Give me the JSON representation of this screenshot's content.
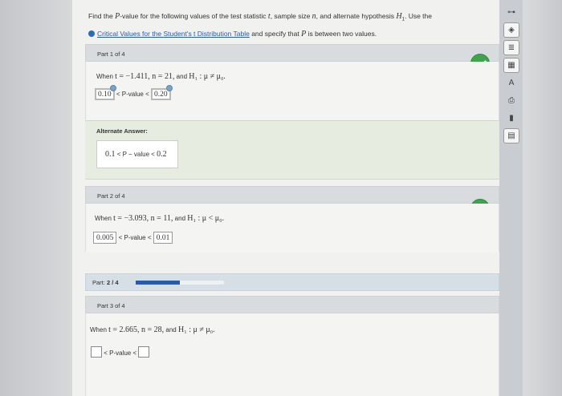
{
  "intro": {
    "line1_pre": "Find the ",
    "line1_p": "P",
    "line1_mid": "-value for the following values of the test statistic ",
    "line1_t": "t",
    "line1_mid2": ", sample size ",
    "line1_n": "n",
    "line1_mid3": ", and alternate hypothesis ",
    "line1_h": "H",
    "line1_h_sub": "1",
    "line1_end": ". Use the",
    "link_text": "Critical Values for the Student's t Distribution Table",
    "line2_mid": " and specify that ",
    "line2_p": "P",
    "line2_end": " is between two values."
  },
  "part1": {
    "label": "Part 1 of 4",
    "when_text": "When ",
    "stat": "t = −1.411, n = 21,",
    "and_text": " and ",
    "hyp": "H₁ : μ ≠ μ₀.",
    "lower": "0.10",
    "mid_text": " < P-value < ",
    "upper": "0.20"
  },
  "alternate": {
    "title": "Alternate Answer:",
    "answer_lower": "0.1",
    "answer_mid": " < P − value < ",
    "answer_upper": "0.2"
  },
  "part2": {
    "label": "Part 2 of 4",
    "when_text": "When ",
    "stat": "t = −3.093, n = 11,",
    "and_text": " and ",
    "hyp": "H₁ : μ < μ₀.",
    "lower": "0.005",
    "mid_text": " < P-value < ",
    "upper": "0.01"
  },
  "progress": {
    "label_prefix": "Part: ",
    "label_value": "2 / 4",
    "fraction": 0.5
  },
  "part3": {
    "label": "Part 3 of 4",
    "when_text": "When ",
    "stat": "t = 2.665, n = 28,",
    "and_text": " and ",
    "hyp": "H₁ : μ ≠ μ₀.",
    "mid_text": " < P-value < "
  },
  "toolbar": {
    "icons": [
      "key-icon",
      "diamond-icon",
      "document-icon",
      "calculator-icon",
      "text-size-icon",
      "print-icon",
      "chart-icon",
      "table-icon"
    ]
  },
  "colors": {
    "check_green": "#3fa34d",
    "progress_blue": "#2a5aa8",
    "alt_panel_bg": "#e6ece0"
  }
}
